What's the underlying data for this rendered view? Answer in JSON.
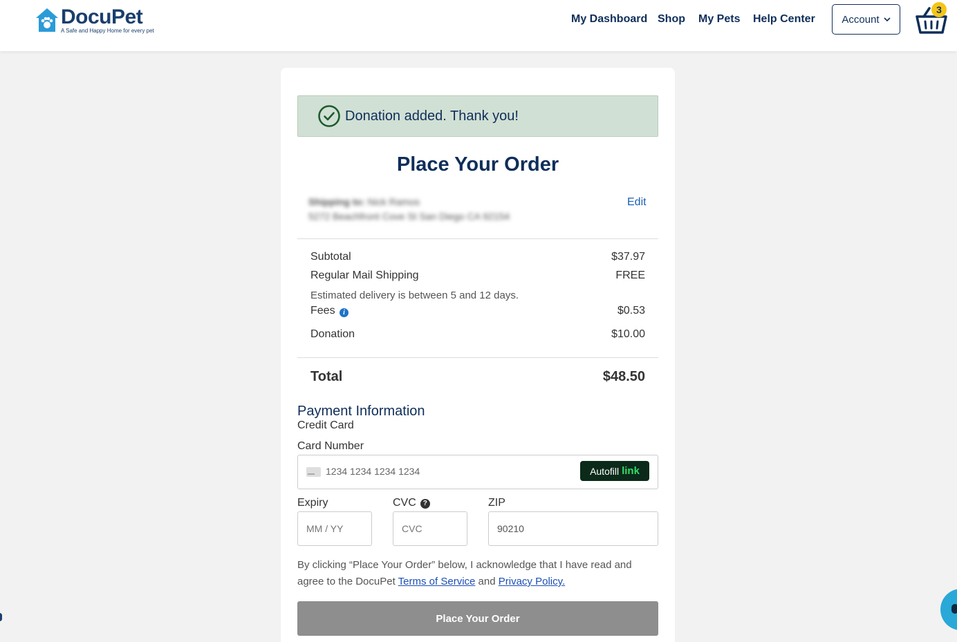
{
  "header": {
    "logo_name": "DocuPet",
    "logo_tagline": "A Safe and Happy Home for every pet",
    "nav": [
      {
        "label": "My Dashboard"
      },
      {
        "label": "Shop"
      },
      {
        "label": "My Pets"
      },
      {
        "label": "Help Center"
      }
    ],
    "account_label": "Account",
    "cart_count": "3"
  },
  "banner": {
    "text": "Donation added. Thank you!"
  },
  "order": {
    "title": "Place Your Order",
    "shipping_label": "Shipping to:",
    "shipping_name": "Nick Ramos",
    "shipping_address": "5272 Beachfront Cove St San Diego CA 92154",
    "edit_label": "Edit",
    "subtotal_label": "Subtotal",
    "subtotal_value": "$37.97",
    "shipping_method_label": "Regular Mail Shipping",
    "shipping_method_value": "FREE",
    "estimated_delivery": "Estimated delivery is between 5 and 12 days.",
    "fees_label": "Fees",
    "fees_value": "$0.53",
    "donation_label": "Donation",
    "donation_value": "$10.00",
    "total_label": "Total",
    "total_value": "$48.50"
  },
  "payment": {
    "heading": "Payment Information",
    "method": "Credit Card",
    "card_number_label": "Card Number",
    "card_number_placeholder": "1234 1234 1234 1234",
    "autofill_label": "Autofill",
    "autofill_link": "link",
    "expiry_label": "Expiry",
    "expiry_placeholder": "MM / YY",
    "cvc_label": "CVC",
    "cvc_placeholder": "CVC",
    "zip_label": "ZIP",
    "zip_value": "90210"
  },
  "legal": {
    "text_before": "By clicking “Place Your Order” below, I acknowledge that I have read and agree to the DocuPet ",
    "terms_link": "Terms of Service",
    "and": " and ",
    "privacy_link": "Privacy Policy."
  },
  "submit_label": "Place Your Order",
  "colors": {
    "brand_navy": "#0f2e5a",
    "banner_bg": "#d1e0d4",
    "button_disabled": "#8e8e8e",
    "link_blue": "#1d4fb5",
    "badge_yellow": "#f5c518"
  },
  "icons": [
    "house-paw-logo",
    "chevron-down-icon",
    "basket-icon",
    "check-circle-icon",
    "info-icon",
    "credit-card-icon",
    "question-icon",
    "chat-icon"
  ]
}
